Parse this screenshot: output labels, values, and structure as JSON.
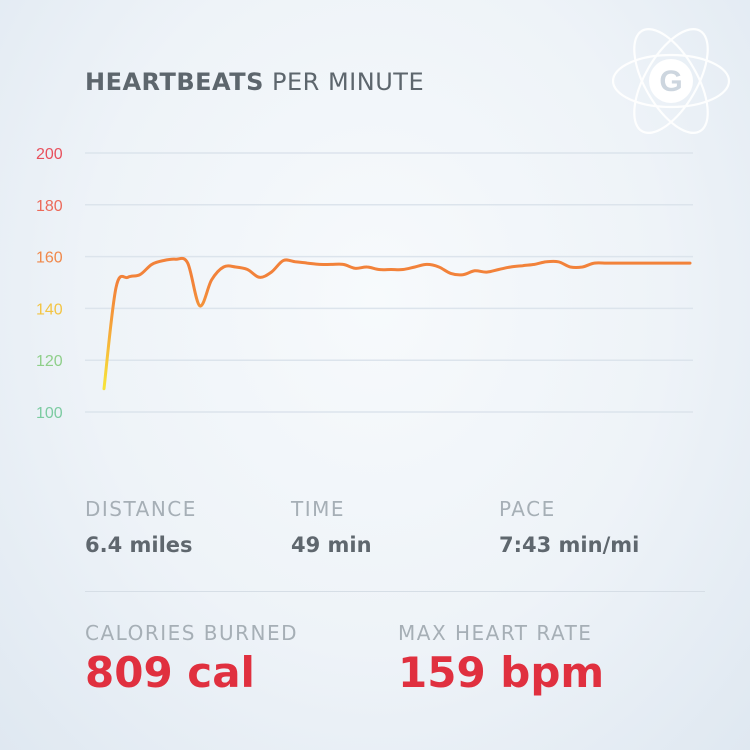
{
  "header": {
    "title_bold": "HEARTBEATS",
    "title_rest": "PER MINUTE",
    "logo_letter": "G"
  },
  "chart_data": {
    "type": "line",
    "ylim": [
      100,
      200
    ],
    "yticks": [
      200,
      180,
      160,
      140,
      120,
      100
    ],
    "grid": true,
    "x": [
      0,
      1,
      2,
      3,
      4,
      5,
      6,
      7,
      8,
      9,
      10,
      11,
      12,
      13,
      14,
      15,
      16,
      17,
      18,
      19,
      20,
      21,
      22,
      23,
      24,
      25,
      26,
      27,
      28,
      29,
      30,
      31,
      32,
      33,
      34,
      35,
      36,
      37,
      38,
      39,
      40,
      41,
      42,
      43,
      44,
      45,
      46,
      47,
      48,
      49
    ],
    "series": [
      {
        "values": [
          109,
          148,
          152,
          153,
          157,
          158.5,
          159,
          157.5,
          141,
          151,
          156,
          156,
          155,
          152,
          154,
          158.5,
          158,
          157.5,
          157,
          157,
          157,
          155.5,
          156,
          155,
          155,
          155,
          156,
          157,
          156,
          153.5,
          153,
          154.5,
          154,
          155,
          156,
          156.5,
          157,
          158,
          158,
          156,
          156,
          157.5,
          157.5,
          157.5,
          157.5,
          157.5,
          157.5,
          157.5,
          157.5,
          157.5
        ]
      }
    ],
    "tick_colors": {
      "200": "#e8505c",
      "180": "#ec6a5a",
      "160": "#f0884a",
      "140": "#f3c443",
      "120": "#8fcf8a",
      "100": "#7ccba1"
    },
    "line_gradient": [
      "#f7e23a",
      "#f7c03a",
      "#f49a3a",
      "#f2823a"
    ]
  },
  "stats": {
    "distance": {
      "label": "DISTANCE",
      "value": "6.4 miles"
    },
    "time": {
      "label": "TIME",
      "value": "49 min"
    },
    "pace": {
      "label": "PACE",
      "value": "7:43 min/mi"
    },
    "calories": {
      "label": "CALORIES BURNED",
      "value": "809 cal"
    },
    "max_hr": {
      "label": "MAX HEART RATE",
      "value": "159 bpm"
    }
  },
  "colors": {
    "accent": "#e0303f",
    "title": "#5d666d",
    "label": "#a6afb6",
    "grid": "#dce4ec"
  }
}
